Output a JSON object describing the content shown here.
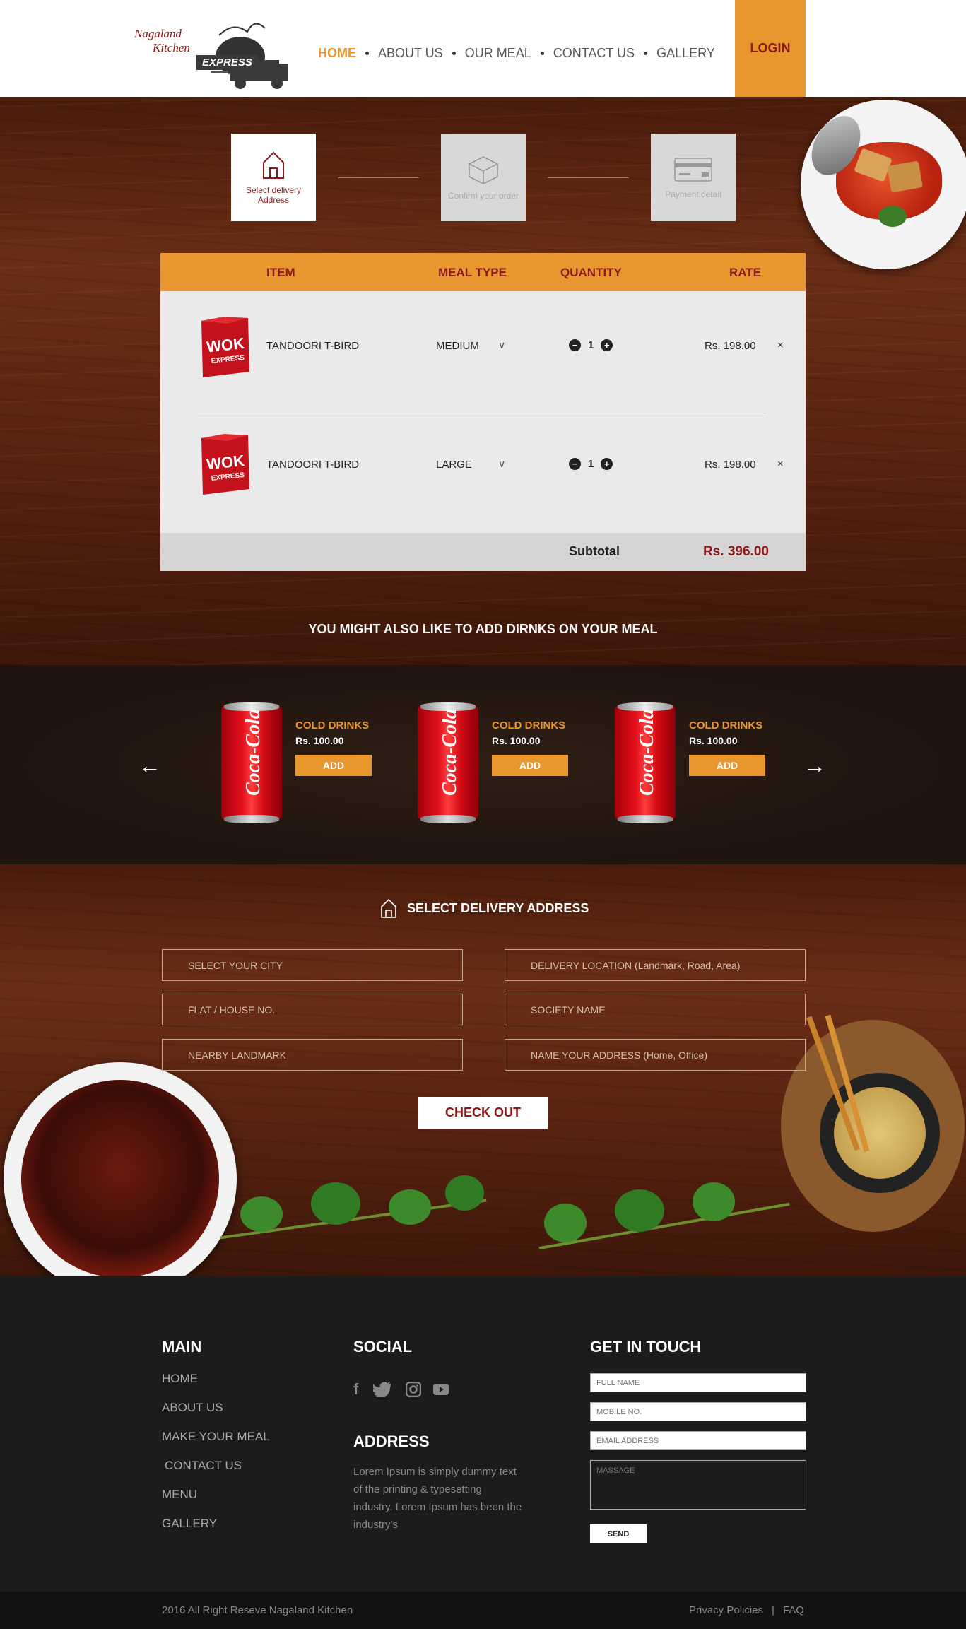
{
  "brand": {
    "line1": "Nagaland",
    "line2": "Kitchen",
    "line3": "EXPRESS"
  },
  "nav": {
    "items": [
      {
        "label": "HOME",
        "active": true
      },
      {
        "label": "ABOUT US",
        "active": false
      },
      {
        "label": "OUR MEAL",
        "active": false
      },
      {
        "label": "CONTACT US",
        "active": false
      },
      {
        "label": "GALLERY",
        "active": false
      }
    ],
    "login": "LOGIN"
  },
  "steps": [
    {
      "label": "Select delivery Address",
      "icon": "home-icon",
      "active": true
    },
    {
      "label": "Confirm your order",
      "icon": "box-icon",
      "active": false
    },
    {
      "label": "Payment detail",
      "icon": "credit-card-icon",
      "active": false
    }
  ],
  "cart": {
    "headers": {
      "item": "ITEM",
      "meal_type": "MEAL TYPE",
      "quantity": "QUANTITY",
      "rate": "RATE"
    },
    "rows": [
      {
        "name": "TANDOORI T-BIRD",
        "meal_type": "MEDIUM",
        "qty": "1",
        "rate": "Rs. 198.00",
        "image": "WOK EXPRESS"
      },
      {
        "name": "TANDOORI T-BIRD",
        "meal_type": "LARGE",
        "qty": "1",
        "rate": "Rs. 198.00",
        "image": "WOK EXPRESS"
      }
    ],
    "remove": "×",
    "chevron": "∨",
    "minus": "−",
    "plus": "+",
    "subtotal_label": "Subtotal",
    "subtotal_value": "Rs. 396.00"
  },
  "drinks": {
    "heading": "YOU MIGHT ALSO LIKE TO ADD DIRNKS ON YOUR MEAL",
    "prev": "←",
    "next": "→",
    "items": [
      {
        "name": "COLD DRINKS",
        "price": "Rs. 100.00",
        "add": "ADD",
        "brand": "Coca-Cola"
      },
      {
        "name": "COLD DRINKS",
        "price": "Rs. 100.00",
        "add": "ADD",
        "brand": "Coca-Cola"
      },
      {
        "name": "COLD DRINKS",
        "price": "Rs. 100.00",
        "add": "ADD",
        "brand": "Coca-Cola"
      }
    ]
  },
  "address": {
    "heading": "SELECT DELIVERY ADDRESS",
    "fields": {
      "city": "SELECT YOUR CITY",
      "location": "DELIVERY LOCATION (Landmark, Road, Area)",
      "house": "FLAT / HOUSE NO.",
      "society": "SOCIETY NAME",
      "landmark": "NEARBY LANDMARK",
      "address_name": "NAME YOUR ADDRESS (Home, Office)"
    },
    "checkout": "CHECK OUT"
  },
  "footer": {
    "main_heading": "MAIN",
    "main_links": [
      "HOME",
      "ABOUT US",
      "MAKE YOUR MEAL",
      "CONTACT US",
      "MENU",
      "GALLERY"
    ],
    "social_heading": "SOCIAL",
    "social_icons": [
      "facebook-icon",
      "twitter-icon",
      "instagram-icon",
      "youtube-icon"
    ],
    "address_heading": "ADDRESS",
    "address_text": "Lorem Ipsum is simply dummy text of the printing & typesetting industry. Lorem Ipsum has been the industry's",
    "contact_heading": "GET IN TOUCH",
    "contact_fields": {
      "name": "FULL NAME",
      "mobile": "MOBILE NO.",
      "email": "EMAIL ADDRESS",
      "message": "MASSAGE"
    },
    "send": "SEND",
    "copyright": "2016 All Right Reseve Nagaland Kitchen",
    "privacy": "Privacy Policies",
    "separator": "|",
    "faq": "FAQ"
  },
  "colors": {
    "accent": "#e8962e",
    "brand_red": "#8b1a1a",
    "wood": "#5a2411",
    "footer_bg": "#1c1c1c"
  }
}
